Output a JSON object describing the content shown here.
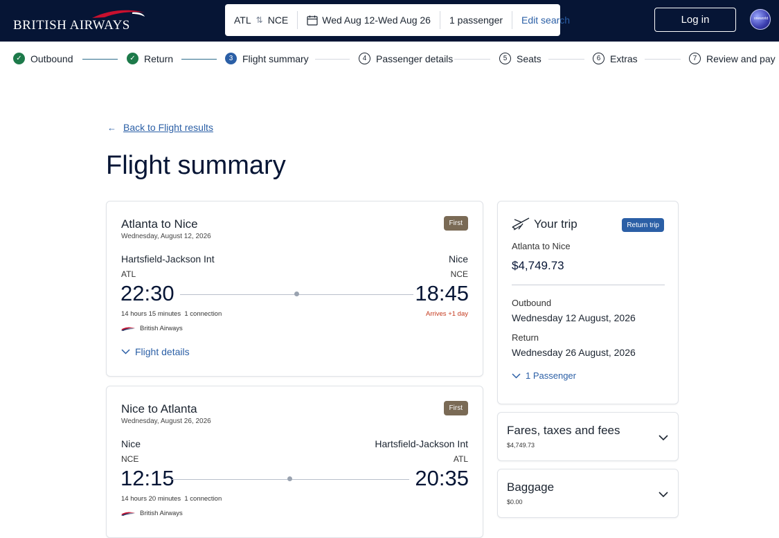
{
  "header": {
    "brand": "BRITISH AIRWAYS",
    "search": {
      "origin": "ATL",
      "destination": "NCE",
      "dates": "Wed Aug 12-Wed Aug 26",
      "passengers": "1 passenger",
      "edit_label": "Edit search"
    },
    "login_label": "Log in",
    "avatar_text": "oneworld"
  },
  "stepper": {
    "steps": [
      {
        "label": "Outbound",
        "status": "done",
        "num": "✓"
      },
      {
        "label": "Return",
        "status": "done",
        "num": "✓"
      },
      {
        "label": "Flight summary",
        "status": "current",
        "num": "3"
      },
      {
        "label": "Passenger details",
        "status": "todo",
        "num": "4"
      },
      {
        "label": "Seats",
        "status": "todo",
        "num": "5"
      },
      {
        "label": "Extras",
        "status": "todo",
        "num": "6"
      },
      {
        "label": "Review and pay",
        "status": "todo",
        "num": "7"
      }
    ]
  },
  "main": {
    "back_label": "Back to Flight results",
    "title": "Flight summary"
  },
  "flights": [
    {
      "title": "Atlanta to Nice",
      "date": "Wednesday, August 12, 2026",
      "cabin": "First",
      "from_airport": "Hartsfield-Jackson Int",
      "from_code": "ATL",
      "to_airport": "Nice",
      "to_code": "NCE",
      "dep_time": "22:30",
      "arr_time": "18:45",
      "duration": "14 hours 15 minutes",
      "connections": "1 connection",
      "arrives_note": "Arrives +1 day",
      "airline": "British Airways",
      "details_label": "Flight details"
    },
    {
      "title": "Nice to Atlanta",
      "date": "Wednesday, August 26, 2026",
      "cabin": "First",
      "from_airport": "Nice",
      "from_code": "NCE",
      "to_airport": "Hartsfield-Jackson Int",
      "to_code": "ATL",
      "dep_time": "12:15",
      "arr_time": "20:35",
      "duration": "14 hours 20 minutes",
      "connections": "1 connection",
      "airline": "British Airways"
    }
  ],
  "trip": {
    "title": "Your trip",
    "badge": "Return trip",
    "route": "Atlanta to Nice",
    "price": "$4,749.73",
    "outbound_label": "Outbound",
    "outbound_date": "Wednesday 12 August, 2026",
    "return_label": "Return",
    "return_date": "Wednesday 26 August, 2026",
    "passenger_label": "1 Passenger"
  },
  "accordions": {
    "fares": {
      "title": "Fares, taxes and fees",
      "amount": "$4,749.73"
    },
    "baggage": {
      "title": "Baggage",
      "amount": "$0.00"
    }
  },
  "colors": {
    "header_bg": "#061535",
    "accent_blue": "#2b5fa6",
    "done_green": "#1d7a4a",
    "cabin_badge": "#7a6a55",
    "arrives_red": "#c4391d"
  }
}
